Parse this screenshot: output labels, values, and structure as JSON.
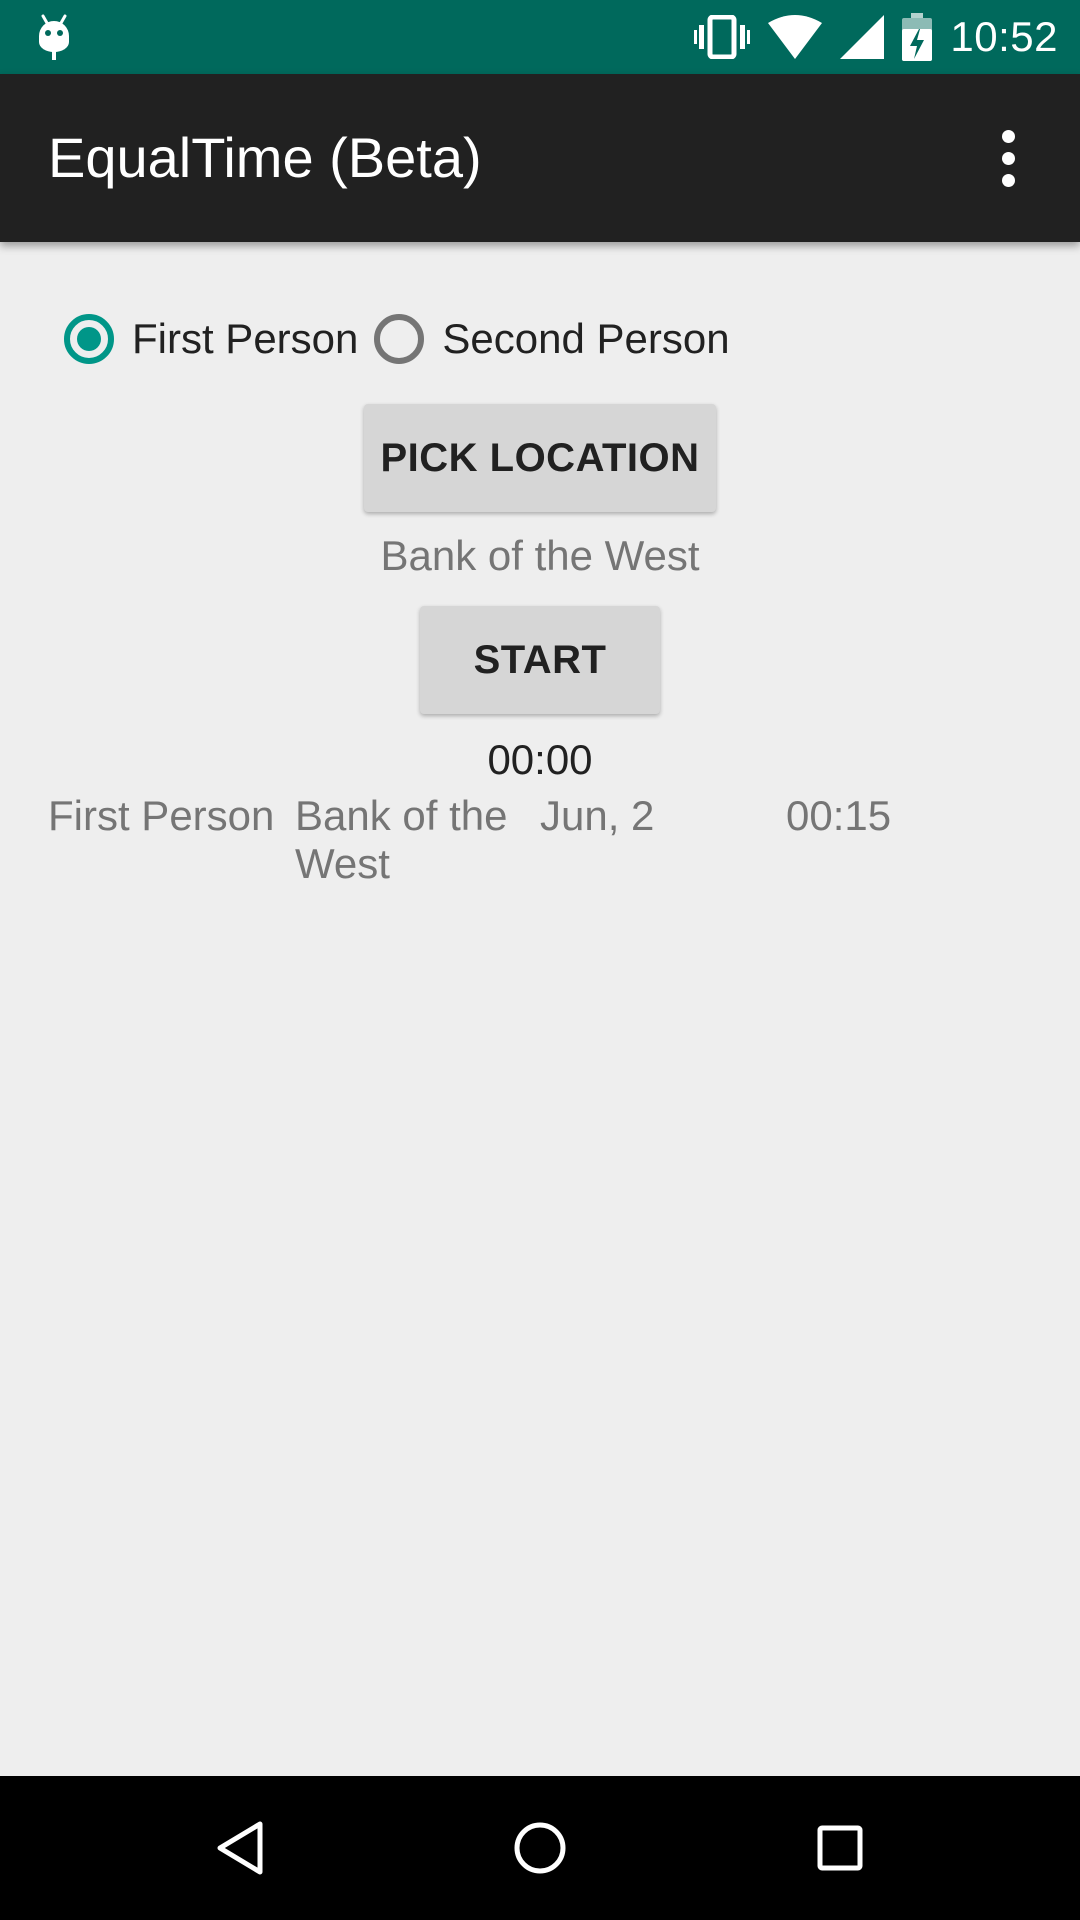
{
  "status_bar": {
    "time": "10:52",
    "icons": [
      "android-debug-icon",
      "vibrate-icon",
      "wifi-icon",
      "signal-icon",
      "battery-charging-icon"
    ]
  },
  "app_bar": {
    "title": "EqualTime (Beta)",
    "menu_icon": "overflow-menu-icon"
  },
  "person_selector": {
    "options": [
      {
        "label": "First Person",
        "checked": true
      },
      {
        "label": "Second Person",
        "checked": false
      }
    ]
  },
  "main": {
    "pick_location_label": "PICK LOCATION",
    "selected_location": "Bank of the West",
    "start_label": "START",
    "timer": "00:00"
  },
  "history": [
    {
      "person": "First Person",
      "location": "Bank of the West",
      "date": "Jun, 2",
      "duration": "00:15"
    }
  ],
  "nav_bar": {
    "icons": [
      "back-icon",
      "home-icon",
      "recents-icon"
    ]
  },
  "colors": {
    "status_bar": "#00695c",
    "app_bar": "#212121",
    "accent": "#009688",
    "background": "#eeeeee",
    "button": "#d6d6d6"
  }
}
